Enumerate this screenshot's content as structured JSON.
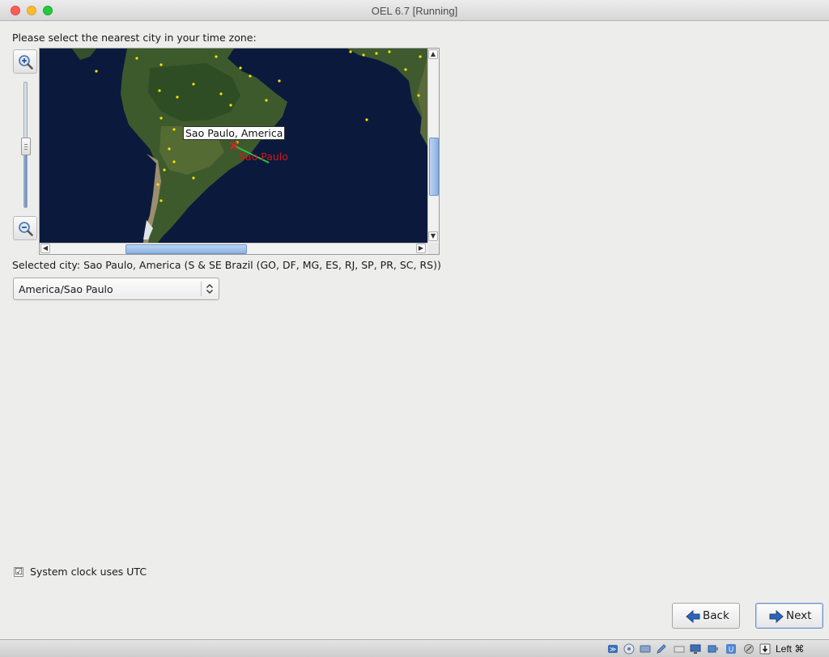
{
  "window": {
    "title": "OEL 6.7 [Running]"
  },
  "installer": {
    "prompt": "Please select the nearest city in your time zone:",
    "map": {
      "tag_label": "Sao Paulo, America",
      "city_label": "Sao Paulo"
    },
    "selected_city": "Selected city: Sao Paulo, America (S & SE Brazil (GO, DF, MG, ES, RJ, SP, PR, SC, RS))",
    "timezone_select": {
      "value": "America/Sao Paulo"
    },
    "utc_checkbox": {
      "label": "System clock uses UTC",
      "checked": true,
      "mark": "☑"
    },
    "buttons": {
      "back": "Back",
      "next": "Next"
    }
  },
  "statusbar": {
    "host_key": "Left ⌘",
    "icons": [
      "hard-disk-icon",
      "optical-drive-icon",
      "audio-icon",
      "pen-icon",
      "network-icon",
      "display-icon",
      "usb-icon",
      "shared-folders-icon",
      "capture-icon",
      "download-icon"
    ]
  }
}
